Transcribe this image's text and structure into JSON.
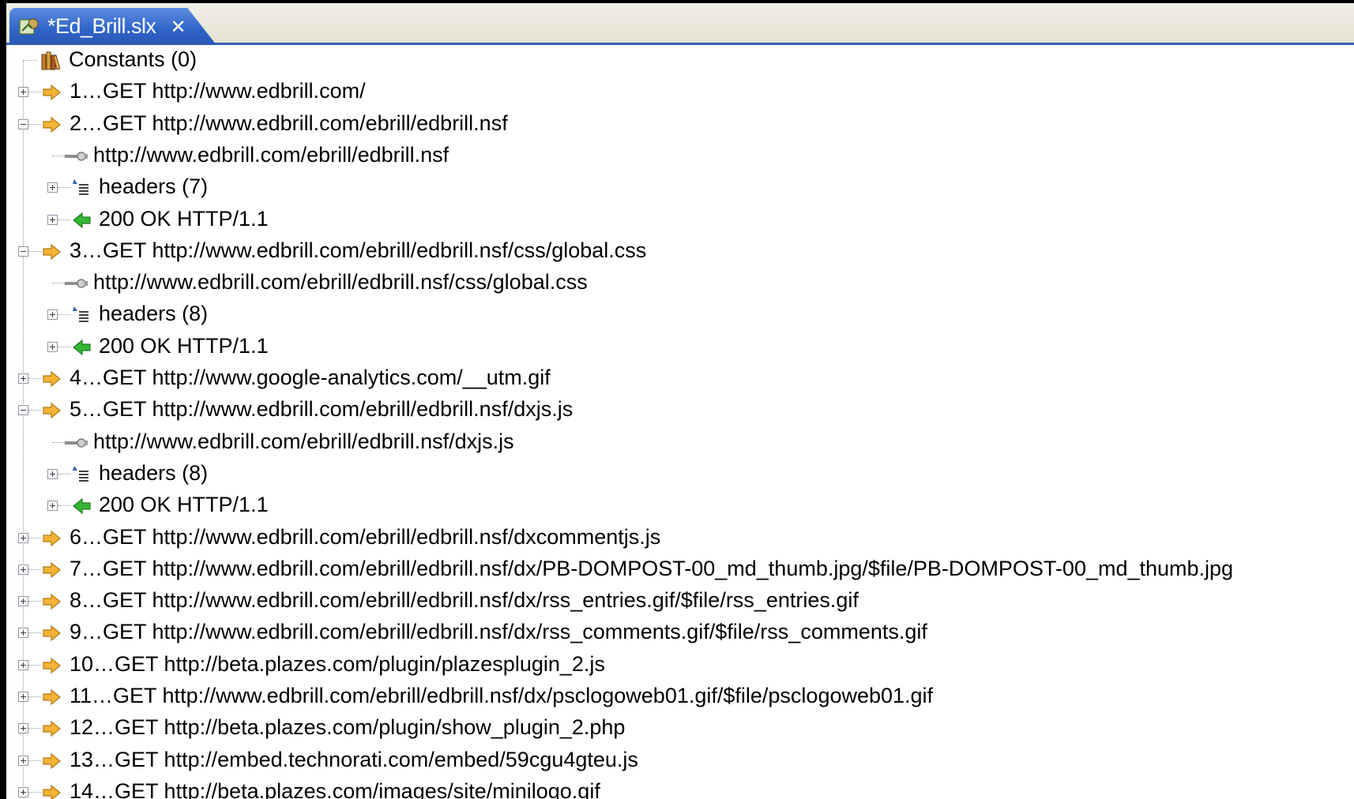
{
  "tab": {
    "title": "*Ed_Brill.slx",
    "close": "✕",
    "icon": "script-icon"
  },
  "tree": {
    "rows": [
      {
        "level": 0,
        "expander": "none",
        "icon": "books-icon",
        "label": "Constants (0)"
      },
      {
        "level": 0,
        "expander": "plus",
        "icon": "request-arrow-icon",
        "label": "1…GET http://www.edbrill.com/"
      },
      {
        "level": 0,
        "expander": "minus",
        "icon": "request-arrow-icon",
        "label": "2…GET http://www.edbrill.com/ebrill/edbrill.nsf"
      },
      {
        "level": 1,
        "expander": "none",
        "icon": "url-plug-icon",
        "label": "http://www.edbrill.com/ebrill/edbrill.nsf"
      },
      {
        "level": 1,
        "expander": "plus",
        "icon": "headers-icon",
        "label": "headers (7)"
      },
      {
        "level": 1,
        "expander": "plus",
        "icon": "response-arrow-icon",
        "label": "200 OK HTTP/1.1"
      },
      {
        "level": 0,
        "expander": "minus",
        "icon": "request-arrow-icon",
        "label": "3…GET http://www.edbrill.com/ebrill/edbrill.nsf/css/global.css"
      },
      {
        "level": 1,
        "expander": "none",
        "icon": "url-plug-icon",
        "label": "http://www.edbrill.com/ebrill/edbrill.nsf/css/global.css"
      },
      {
        "level": 1,
        "expander": "plus",
        "icon": "headers-icon",
        "label": "headers (8)"
      },
      {
        "level": 1,
        "expander": "plus",
        "icon": "response-arrow-icon",
        "label": "200 OK HTTP/1.1"
      },
      {
        "level": 0,
        "expander": "plus",
        "icon": "request-arrow-icon",
        "label": "4…GET http://www.google-analytics.com/__utm.gif"
      },
      {
        "level": 0,
        "expander": "minus",
        "icon": "request-arrow-icon",
        "label": "5…GET http://www.edbrill.com/ebrill/edbrill.nsf/dxjs.js"
      },
      {
        "level": 1,
        "expander": "none",
        "icon": "url-plug-icon",
        "label": "http://www.edbrill.com/ebrill/edbrill.nsf/dxjs.js"
      },
      {
        "level": 1,
        "expander": "plus",
        "icon": "headers-icon",
        "label": "headers (8)"
      },
      {
        "level": 1,
        "expander": "plus",
        "icon": "response-arrow-icon",
        "label": "200 OK HTTP/1.1"
      },
      {
        "level": 0,
        "expander": "plus",
        "icon": "request-arrow-icon",
        "label": "6…GET http://www.edbrill.com/ebrill/edbrill.nsf/dxcommentjs.js"
      },
      {
        "level": 0,
        "expander": "plus",
        "icon": "request-arrow-icon",
        "label": "7…GET http://www.edbrill.com/ebrill/edbrill.nsf/dx/PB-DOMPOST-00_md_thumb.jpg/$file/PB-DOMPOST-00_md_thumb.jpg"
      },
      {
        "level": 0,
        "expander": "plus",
        "icon": "request-arrow-icon",
        "label": "8…GET http://www.edbrill.com/ebrill/edbrill.nsf/dx/rss_entries.gif/$file/rss_entries.gif"
      },
      {
        "level": 0,
        "expander": "plus",
        "icon": "request-arrow-icon",
        "label": "9…GET http://www.edbrill.com/ebrill/edbrill.nsf/dx/rss_comments.gif/$file/rss_comments.gif"
      },
      {
        "level": 0,
        "expander": "plus",
        "icon": "request-arrow-icon",
        "label": "10…GET http://beta.plazes.com/plugin/plazesplugin_2.js"
      },
      {
        "level": 0,
        "expander": "plus",
        "icon": "request-arrow-icon",
        "label": "11…GET http://www.edbrill.com/ebrill/edbrill.nsf/dx/psclogoweb01.gif/$file/psclogoweb01.gif"
      },
      {
        "level": 0,
        "expander": "plus",
        "icon": "request-arrow-icon",
        "label": "12…GET http://beta.plazes.com/plugin/show_plugin_2.php"
      },
      {
        "level": 0,
        "expander": "plus",
        "icon": "request-arrow-icon",
        "label": "13…GET http://embed.technorati.com/embed/59cgu4gteu.js"
      },
      {
        "level": 0,
        "expander": "plus",
        "icon": "request-arrow-icon",
        "label": "14…GET http://beta.plazes.com/images/site/minilogo.gif"
      }
    ]
  },
  "colors": {
    "tab_blue": "#2f63c8",
    "request_arrow": "#f5b335",
    "response_arrow": "#35b535",
    "panel_bg": "#ffffff"
  }
}
